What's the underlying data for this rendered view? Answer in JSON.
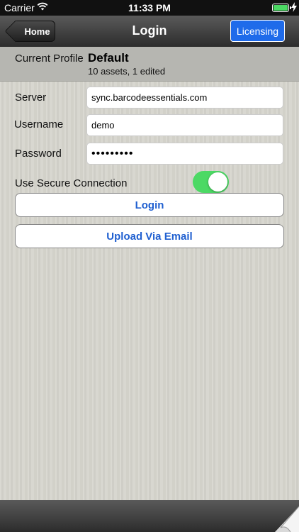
{
  "status_bar": {
    "carrier": "Carrier",
    "time": "11:33 PM",
    "icons": [
      "wifi-icon",
      "battery-icon",
      "charging-icon"
    ]
  },
  "nav": {
    "back_label": "Home",
    "title": "Login",
    "licensing_label": "Licensing"
  },
  "profile": {
    "label": "Current Profile",
    "name": "Default",
    "summary": "10 assets, 1 edited"
  },
  "form": {
    "server_label": "Server",
    "server_value": "sync.barcodeessentials.com",
    "username_label": "Username",
    "username_value": "demo",
    "password_label": "Password",
    "password_value": "demo12345",
    "secure_label": "Use Secure Connection",
    "secure_enabled": true
  },
  "actions": {
    "login_label": "Login",
    "upload_label": "Upload Via Email"
  },
  "colors": {
    "accent": "#1f6bea",
    "toggle_on": "#4cd964",
    "button_text": "#1f5fd0"
  }
}
